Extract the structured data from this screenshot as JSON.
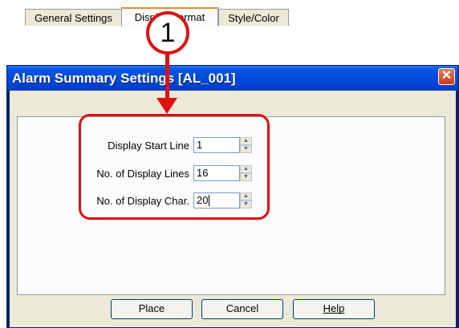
{
  "callout": {
    "number": "1"
  },
  "window": {
    "title": "Alarm Summary Settings [AL_001]",
    "close_glyph": "✕"
  },
  "tabs": [
    {
      "label": "General Settings",
      "active": false
    },
    {
      "label": "Display Format",
      "active": true
    },
    {
      "label": "Style/Color",
      "active": false
    }
  ],
  "fields": [
    {
      "label": "Display Start Line",
      "value": "1"
    },
    {
      "label": "No. of Display Lines",
      "value": "16"
    },
    {
      "label": "No. of Display Char.",
      "value": "20"
    }
  ],
  "buttons": {
    "place": "Place",
    "cancel": "Cancel",
    "help": "Help"
  },
  "colors": {
    "callout": "#e01010",
    "titlebar": "#0054e3",
    "dialog_bg": "#ece9d8",
    "panel_bg": "#fcfcfe"
  }
}
